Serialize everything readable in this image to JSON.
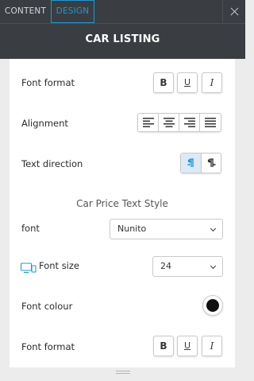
{
  "tabs": {
    "content": "CONTENT",
    "design": "DESIGN"
  },
  "header": {
    "title": "CAR LISTING"
  },
  "rows": {
    "font_format_1": "Font format",
    "alignment": "Alignment",
    "text_direction": "Text direction",
    "section_title": "Car Price Text Style",
    "font": "font",
    "font_size": "Font size",
    "font_colour": "Font colour",
    "font_format_2": "Font format"
  },
  "format_buttons": {
    "bold": "B",
    "underline": "U",
    "italic": "I"
  },
  "font_select": {
    "value": "Nunito"
  },
  "size_select": {
    "value": "24"
  },
  "colors": {
    "accent": "#1c9ad6",
    "header_bg": "#3a3d41",
    "font_colour": "#111111"
  },
  "icons": {
    "close": "close-icon",
    "align_left": "align-left-icon",
    "align_center": "align-center-icon",
    "align_right": "align-right-icon",
    "align_justify": "align-justify-icon",
    "ltr": "ltr-direction-icon",
    "rtl": "rtl-direction-icon",
    "device": "desktop-mobile-icon",
    "chevron": "chevron-down-icon",
    "grip": "drag-handle-icon"
  }
}
